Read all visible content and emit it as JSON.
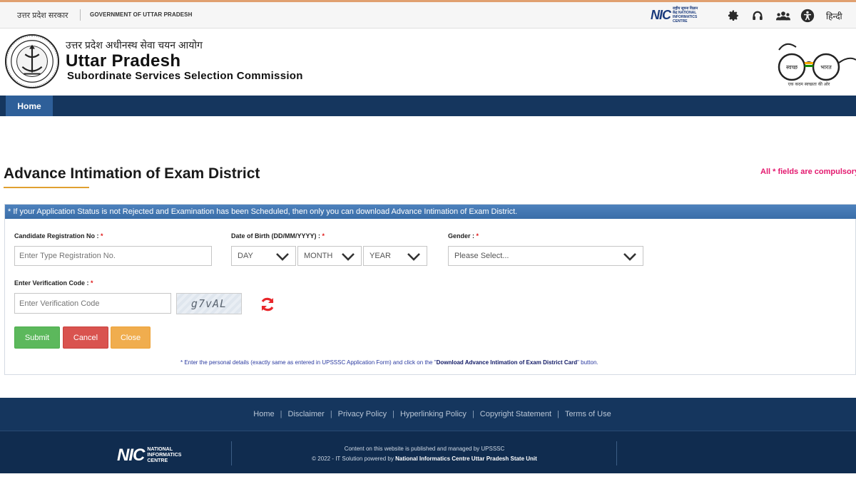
{
  "topbar": {
    "gov_hindi": "उत्तर प्रदेश सरकार",
    "gov_english": "GOVERNMENT OF UTTAR PRADESH",
    "nic_logo_text": "NIC",
    "nic_logo_subtext": "राष्ट्रीय सूचना विज्ञान केंद्र NATIONAL INFORMATICS CENTRE",
    "icons": [
      "gear-icon",
      "headset-icon",
      "users-icon",
      "accessibility-icon"
    ],
    "language_link": "हिन्दी"
  },
  "header": {
    "org_name_hindi": "उत्तर प्रदेश अधीनस्थ सेवा चयन आयोग",
    "org_name_main": "Uttar Pradesh",
    "org_name_sub": "Subordinate Services Selection Commission",
    "swachh_left": "स्वच्छ",
    "swachh_right": "भारत",
    "swachh_tagline": "एक कदम स्वच्छता की ओर"
  },
  "nav": {
    "home_label": "Home"
  },
  "page": {
    "title": "Advance Intimation of Exam District",
    "required_note": "All * fields are compulsory"
  },
  "form": {
    "notice": "* If your Application Status is not Rejected and Examination has been Scheduled, then only you can download Advance Intimation of Exam District.",
    "registration_label": "Candidate Registration No :",
    "registration_placeholder": "Enter Type Registration No.",
    "dob_label": "Date of Birth (DD/MM/YYYY) :",
    "dob_day": "DAY",
    "dob_month": "MONTH",
    "dob_year": "YEAR",
    "gender_label": "Gender :",
    "gender_value": "Please Select...",
    "verification_label": "Enter Verification Code :",
    "verification_placeholder": "Enter Verification Code",
    "captcha_text": "g7vAL",
    "required_mark": "*",
    "submit_label": "Submit",
    "cancel_label": "Cancel",
    "close_label": "Close",
    "instruction_prefix": "* Enter the personal details (exactly same as entered in UPSSSC Application Form) and click on the \"",
    "instruction_action": "Download Advance Intimation of Exam District Card",
    "instruction_suffix": "\" button."
  },
  "footer": {
    "links": [
      "Home",
      "Disclaimer",
      "Privacy Policy",
      "Hyperlinking Policy",
      "Copyright Statement",
      "Terms of Use"
    ],
    "separator": "|",
    "nic_logo_text": "NIC",
    "nic_logo_subtext": "NATIONAL INFORMATICS CENTRE",
    "managed_by": "Content on this website is published and managed by UPSSSC",
    "copyright_prefix": "© 2022 - IT Solution powered by",
    "copyright_org": "National Informatics Centre Uttar Pradesh State Unit"
  },
  "colors": {
    "nav_bg": "#15365e",
    "nav_active": "#2e5f99",
    "panel_head": "#3a6ea8",
    "required": "#e3186e",
    "submit": "#5cb85c",
    "cancel": "#d9534f",
    "close": "#f0ad4e"
  }
}
